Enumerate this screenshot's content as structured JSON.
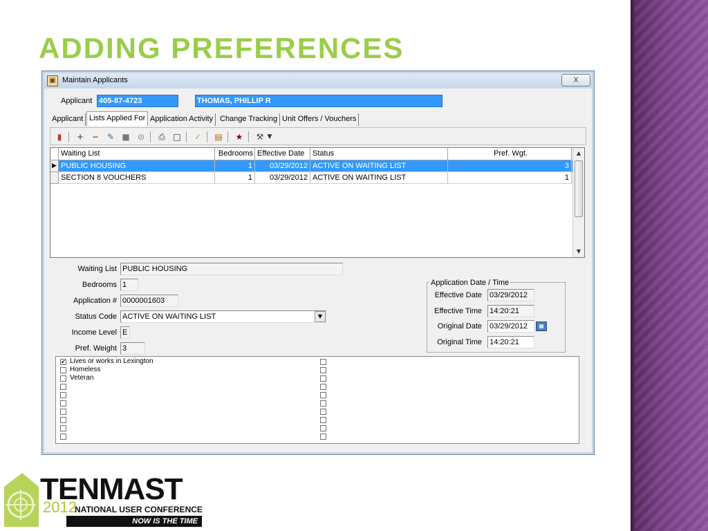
{
  "slide": {
    "title": "ADDING PREFERENCES"
  },
  "window": {
    "title": "Maintain Applicants",
    "close_label": "X",
    "applicant_label": "Applicant",
    "applicant_ssn": "405-87-4723",
    "applicant_name": "THOMAS, PHILLIP R"
  },
  "tabs": [
    {
      "label": "Applicant"
    },
    {
      "label": "Lists Applied For",
      "active": true
    },
    {
      "label": "Application Activity"
    },
    {
      "label": "Change Tracking"
    },
    {
      "label": "Unit Offers / Vouchers"
    }
  ],
  "toolbar": {
    "icons": [
      "exit-icon",
      "add-icon",
      "remove-icon",
      "edit-icon",
      "save-icon",
      "cancel-icon",
      "print-icon",
      "copy-icon",
      "highlighter-icon",
      "layout-icon",
      "notes-icon",
      "tools-icon"
    ]
  },
  "grid": {
    "columns": [
      "Waiting List",
      "Bedrooms",
      "Effective Date",
      "Status",
      "Pref. Wgt."
    ],
    "rows": [
      {
        "waiting_list": "PUBLIC HOUSING",
        "bedrooms": "1",
        "effective_date": "03/29/2012",
        "status": "ACTIVE ON WAITING LIST",
        "pref_wgt": "3",
        "selected": true
      },
      {
        "waiting_list": "SECTION 8 VOUCHERS",
        "bedrooms": "1",
        "effective_date": "03/29/2012",
        "status": "ACTIVE ON WAITING LIST",
        "pref_wgt": "1",
        "selected": false
      }
    ]
  },
  "detail": {
    "waiting_list_label": "Waiting List",
    "waiting_list_value": "PUBLIC HOUSING",
    "bedrooms_label": "Bedrooms",
    "bedrooms_value": "1",
    "application_no_label": "Application #",
    "application_no_value": "0000001603",
    "status_code_label": "Status Code",
    "status_code_value": "ACTIVE ON WAITING LIST",
    "income_level_label": "Income Level",
    "income_level_value": "E",
    "pref_weight_label": "Pref. Weight",
    "pref_weight_value": "3"
  },
  "app_date_group": {
    "title": "Application Date / Time",
    "effective_date_label": "Effective Date",
    "effective_date_value": "03/29/2012",
    "effective_time_label": "Effective Time",
    "effective_time_value": "14:20:21",
    "original_date_label": "Original Date",
    "original_date_value": "03/29/2012",
    "original_time_label": "Original Time",
    "original_time_value": "14:20:21"
  },
  "preferences": [
    {
      "label": "Lives or works in Lexington",
      "checked": true
    },
    {
      "label": "Homeless",
      "checked": false
    },
    {
      "label": "Veteran",
      "checked": false
    }
  ],
  "logo": {
    "name": "TENMAST",
    "year": "2012",
    "subtitle": "NATIONAL USER CONFERENCE",
    "tagline": "NOW IS THE TIME"
  },
  "colors": {
    "title_green": "#9ACD49",
    "selection_blue": "#3399ff",
    "side_purple": "#7a3f87"
  }
}
